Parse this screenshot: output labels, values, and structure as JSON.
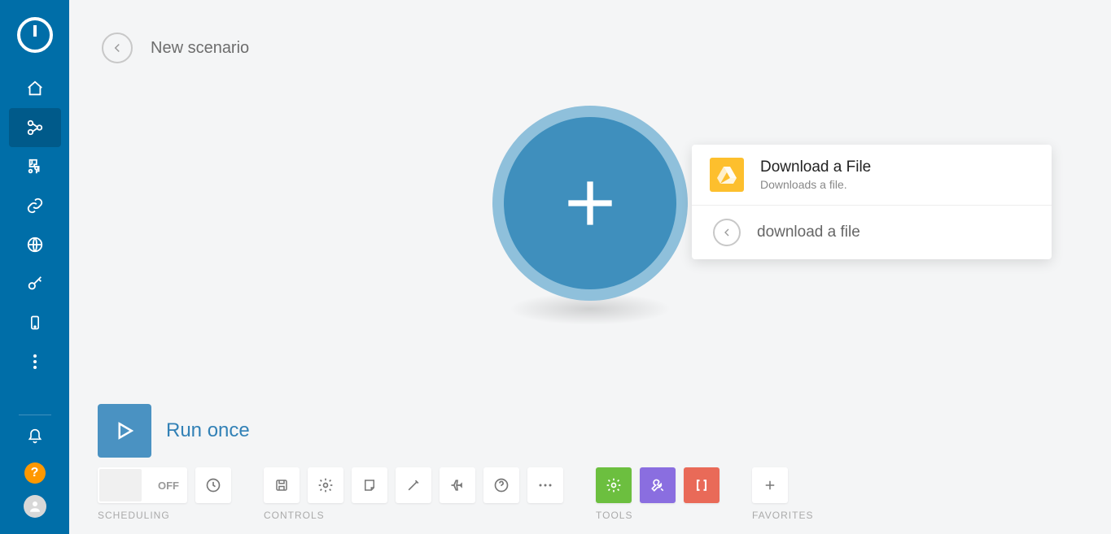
{
  "header": {
    "title": "New scenario"
  },
  "module": {
    "icon": "plus"
  },
  "picker": {
    "option": {
      "title": "Download a File",
      "subtitle": "Downloads a file.",
      "app_icon": "google-drive"
    },
    "search_value": "download a file"
  },
  "run": {
    "label": "Run once"
  },
  "scheduling": {
    "state": "OFF",
    "label": "SCHEDULING"
  },
  "controls": {
    "label": "CONTROLS"
  },
  "tools": {
    "label": "TOOLS"
  },
  "favorites": {
    "label": "FAVORITES"
  }
}
